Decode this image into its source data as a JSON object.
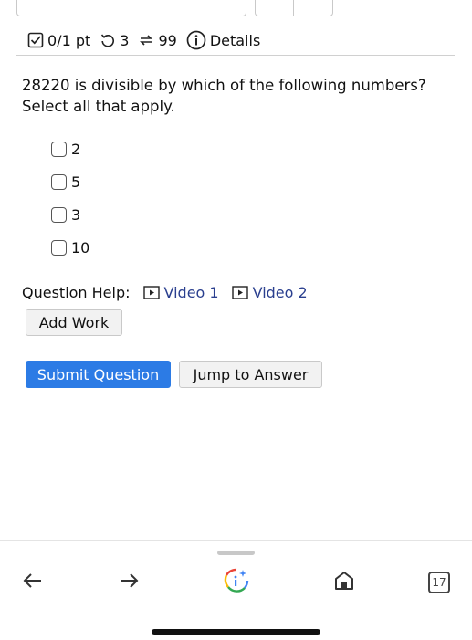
{
  "header": {
    "score": "0/1 pt",
    "retries": "3",
    "attempts": "99",
    "details_label": "Details"
  },
  "question": {
    "text": "28220 is divisible by which of the following numbers? Select all that apply.",
    "options": [
      "2",
      "5",
      "3",
      "10"
    ]
  },
  "help": {
    "label": "Question Help:",
    "video1": "Video 1",
    "video2": "Video 2"
  },
  "actions": {
    "add_work": "Add Work",
    "submit": "Submit Question",
    "jump": "Jump to Answer"
  },
  "browser": {
    "tab_count": "17"
  },
  "colors": {
    "submit_bg": "#2c7be5",
    "link": "#2a3f8f"
  }
}
